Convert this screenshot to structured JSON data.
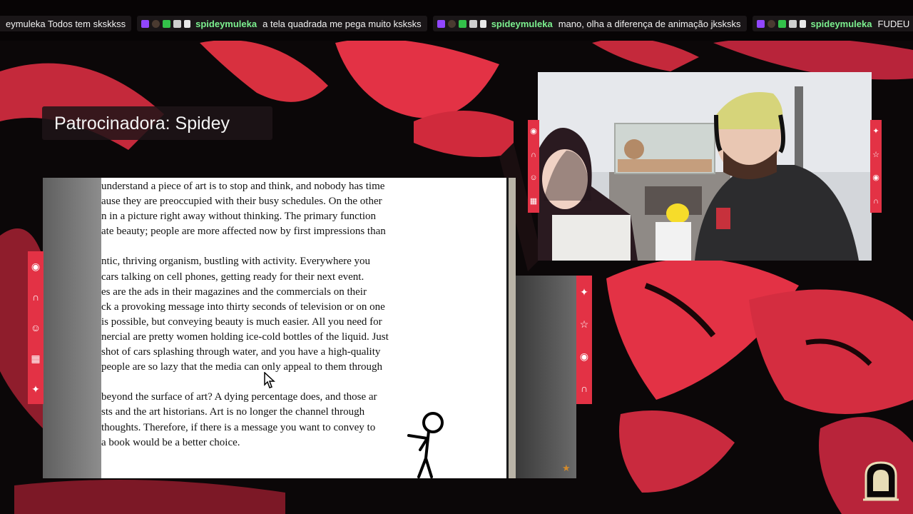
{
  "chat_ticker": [
    {
      "user": "",
      "text": "eymuleka Todos tem skskkss"
    },
    {
      "user": "spideymuleka",
      "text": "a tela quadrada me pega muito ksksks"
    },
    {
      "user": "spideymuleka",
      "text": "mano, olha a diferença de animação jksksks"
    },
    {
      "user": "spideymuleka",
      "text": "FUDEU"
    }
  ],
  "sponsor": {
    "label": "Patrocinadora: Spidey"
  },
  "document": {
    "lines": [
      "understand a piece of art is to stop and think, and nobody has time",
      "ause they are preoccupied with their busy schedules.  On the other",
      "n in a picture right away without thinking.  The primary function",
      "ate beauty; people are more affected now by first impressions than",
      "",
      "ntic, thriving organism, bustling with activity.  Everywhere you",
      " cars talking on cell phones, getting ready for their next event.",
      "es are the ads in their magazines and the commercials on their",
      "ck a provoking message into thirty seconds of television or on one",
      "is possible, but conveying beauty is much easier.  All you need for",
      "nercial are pretty women holding ice-cold bottles of the liquid.  Just",
      " shot of cars splashing through water, and you have a high-quality",
      "people are so lazy that the media can only appeal to them through",
      "",
      "beyond the surface of art?  A dying percentage does, and those ar",
      "sts and the art historians.  Art is no longer the channel through",
      " thoughts.  Therefore, if there is a message you want to convey to",
      "a book would be a better choice."
    ]
  },
  "icons": {
    "strip_left": [
      "eye-icon",
      "tombstone-icon",
      "smile-icon",
      "card-icon",
      "sparkle-icon"
    ],
    "strip_middle": [
      "sparkle-icon",
      "pentagram-icon",
      "eye-icon",
      "tombstone-icon"
    ],
    "strip_cam_left": [
      "eye-icon",
      "tombstone-icon",
      "smile-icon",
      "card-icon"
    ],
    "strip_cam_right": [
      "sparkle-icon",
      "pentagram-icon",
      "eye-icon",
      "tombstone-icon"
    ],
    "logo": "ghost-tombstone-logo"
  },
  "colors": {
    "accent_red": "#e33245",
    "username_green": "#7cf08f",
    "background": "#0b0708"
  }
}
